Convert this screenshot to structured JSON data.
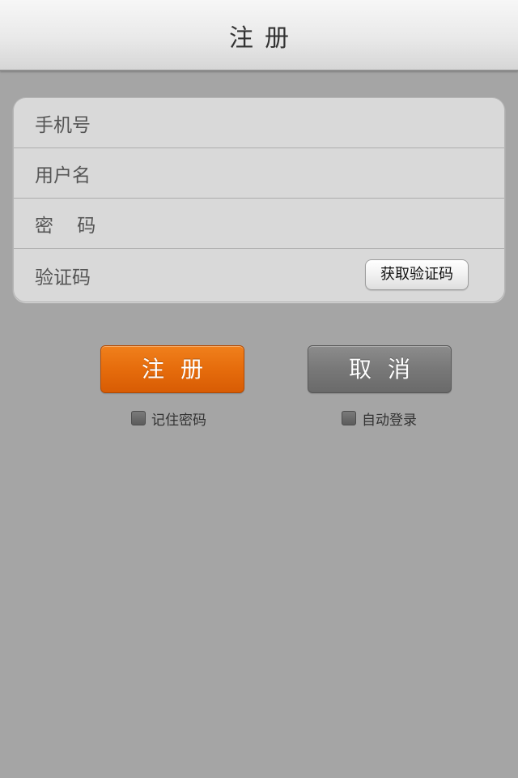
{
  "navbar": {
    "title": "注册"
  },
  "form": {
    "phone_label": "手机号",
    "username_label": "用户名",
    "password_label": "密    码",
    "code_label": "验证码",
    "get_code_button": "获取验证码"
  },
  "actions": {
    "register_label": "注册",
    "cancel_label": "取消"
  },
  "options": {
    "remember_password": "记住密码",
    "remember_password_checked": false,
    "auto_login": "自动登录",
    "auto_login_checked": false
  },
  "colors": {
    "register_button": "#e66c0c",
    "cancel_button": "#787878",
    "background": "#a5a5a5"
  }
}
